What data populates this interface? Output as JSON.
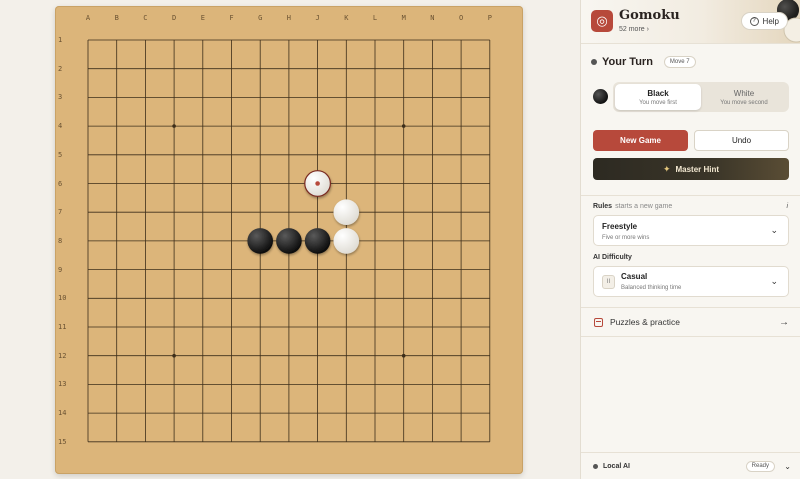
{
  "app": {
    "title": "Gomoku",
    "more_link": "52 more ›",
    "help_label": "Help",
    "logo_icon": "game-logo-icon"
  },
  "board": {
    "columns": [
      "A",
      "B",
      "C",
      "D",
      "E",
      "F",
      "G",
      "H",
      "J",
      "K",
      "L",
      "M",
      "N",
      "O",
      "P"
    ],
    "rows": [
      "1",
      "2",
      "3",
      "4",
      "5",
      "6",
      "7",
      "8",
      "9",
      "10",
      "11",
      "12",
      "13",
      "14",
      "15"
    ],
    "star_points": [
      [
        "D",
        "4"
      ],
      [
        "M",
        "4"
      ],
      [
        "D",
        "12"
      ],
      [
        "M",
        "12"
      ]
    ],
    "stones": [
      {
        "color": "white",
        "col": "J",
        "row": "6",
        "last_move": true
      },
      {
        "color": "white",
        "col": "K",
        "row": "7"
      },
      {
        "color": "black",
        "col": "G",
        "row": "8"
      },
      {
        "color": "black",
        "col": "H",
        "row": "8"
      },
      {
        "color": "black",
        "col": "J",
        "row": "8"
      },
      {
        "color": "white",
        "col": "K",
        "row": "8"
      }
    ],
    "colors": {
      "wood": "#dcb57a",
      "line": "#3d2e1a"
    }
  },
  "turn": {
    "label": "Your Turn",
    "move_badge": "Move 7"
  },
  "side": {
    "black_label": "Black",
    "black_sub": "You move first",
    "white_label": "White",
    "white_sub": "You move second",
    "selected": "Black"
  },
  "actions": {
    "new_game": "New Game",
    "undo": "Undo",
    "hint": "Master Hint"
  },
  "rules": {
    "label": "Rules",
    "sublabel": "starts a new game",
    "info": "i",
    "value": "Freestyle",
    "description": "Five or more wins"
  },
  "difficulty": {
    "label": "AI Difficulty",
    "value": "Casual",
    "description": "Balanced thinking time",
    "icon_text": "II"
  },
  "puzzles": {
    "label": "Puzzles & practice"
  },
  "footer": {
    "label": "Local AI",
    "status": "Ready"
  },
  "theme": {
    "accent": "#b7493b",
    "hint_bg": "#2d2a22"
  }
}
